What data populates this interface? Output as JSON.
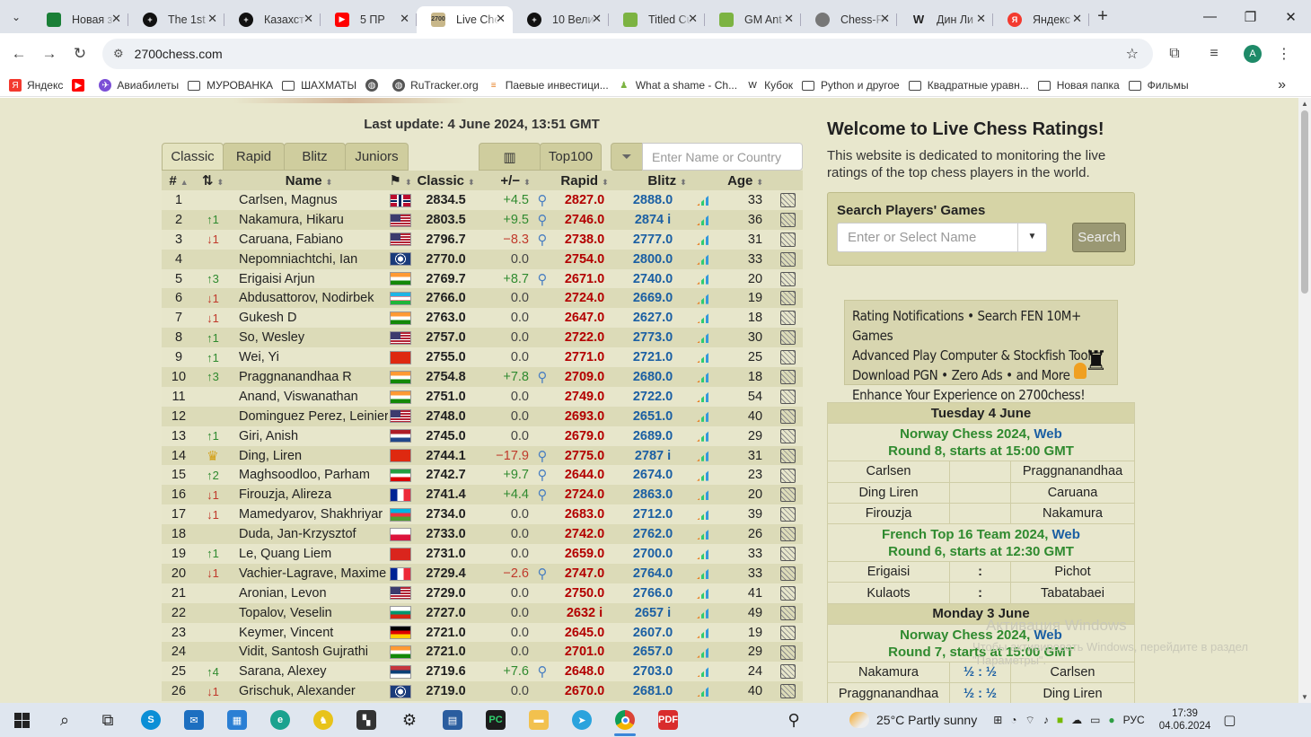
{
  "browser": {
    "tabs": [
      {
        "title": "Новая за",
        "icon": "green-square",
        "color": "#1a7f37",
        "active": false
      },
      {
        "title": "The 1st",
        "icon": "plus-circle",
        "color": "#111111",
        "active": false
      },
      {
        "title": "Казахст",
        "icon": "plus-circle",
        "color": "#111111",
        "active": false
      },
      {
        "title": "5 ПР",
        "icon": "youtube",
        "color": "#ff0000",
        "active": false
      },
      {
        "title": "Live Che",
        "icon": "2700",
        "color": "#c8b78a",
        "active": true
      },
      {
        "title": "10 Вели",
        "icon": "plus-circle",
        "color": "#111111",
        "active": false
      },
      {
        "title": "Titled Cu",
        "icon": "pawn",
        "color": "#7cb342",
        "active": false
      },
      {
        "title": "GM Ant",
        "icon": "pawn",
        "color": "#7cb342",
        "active": false
      },
      {
        "title": "Chess-R",
        "icon": "globe",
        "color": "#777777",
        "active": false
      },
      {
        "title": "Дин Ли",
        "icon": "wikipedia",
        "color": "#222222",
        "active": false
      },
      {
        "title": "Яндекс",
        "icon": "yandex",
        "color": "#f33a2f",
        "active": false
      }
    ],
    "url": "2700chess.com",
    "avatar": "A",
    "bookmarks": [
      {
        "label": "Яндекс",
        "icon": "yandex"
      },
      {
        "label": "",
        "icon": "youtube"
      },
      {
        "label": "Авиабилеты",
        "icon": "aviasales"
      },
      {
        "label": "МУРОВАНКА",
        "icon": "folder"
      },
      {
        "label": "ШАХМАТЫ",
        "icon": "folder"
      },
      {
        "label": "",
        "icon": "globe"
      },
      {
        "label": "RuTracker.org",
        "icon": "globe"
      },
      {
        "label": "Паевые инвестици...",
        "icon": "bars"
      },
      {
        "label": "What a shame - Ch...",
        "icon": "pawn"
      },
      {
        "label": "Кубок",
        "icon": "wikipedia"
      },
      {
        "label": "Python и другое",
        "icon": "folder"
      },
      {
        "label": "Квадратные уравн...",
        "icon": "folder"
      },
      {
        "label": "Новая папка",
        "icon": "folder"
      },
      {
        "label": "Фильмы",
        "icon": "folder"
      }
    ]
  },
  "page": {
    "last_update": "Last update: 4 June 2024, 13:51 GMT",
    "tabs": [
      "Classic",
      "Rapid",
      "Blitz",
      "Juniors"
    ],
    "top100": "Top100",
    "filter_placeholder": "Enter Name or Country",
    "columns": {
      "rank": "#",
      "name": "Name",
      "classic": "Classic",
      "delta": "+/−",
      "rapid": "Rapid",
      "blitz": "Blitz",
      "age": "Age"
    },
    "players": [
      {
        "rank": "1",
        "chg": "",
        "chg_type": "",
        "name": "Carlsen, Magnus",
        "flag": "no",
        "classic": "2834.5",
        "delta": "+4.5",
        "mag": true,
        "rapid": "2827.0",
        "blitz": "2888.0",
        "age": "33"
      },
      {
        "rank": "2",
        "chg": "↑1",
        "chg_type": "up",
        "name": "Nakamura, Hikaru",
        "flag": "us",
        "classic": "2803.5",
        "delta": "+9.5",
        "mag": true,
        "rapid": "2746.0",
        "blitz": "2874 i",
        "age": "36"
      },
      {
        "rank": "3",
        "chg": "↓1",
        "chg_type": "dn",
        "name": "Caruana, Fabiano",
        "flag": "us",
        "classic": "2796.7",
        "delta": "−8.3",
        "mag": true,
        "rapid": "2738.0",
        "blitz": "2777.0",
        "age": "31"
      },
      {
        "rank": "4",
        "chg": "",
        "chg_type": "",
        "name": "Nepomniachtchi, Ian",
        "flag": "fide",
        "classic": "2770.0",
        "delta": "0.0",
        "mag": false,
        "rapid": "2754.0",
        "blitz": "2800.0",
        "age": "33"
      },
      {
        "rank": "5",
        "chg": "↑3",
        "chg_type": "up",
        "name": "Erigaisi Arjun",
        "flag": "in",
        "classic": "2769.7",
        "delta": "+8.7",
        "mag": true,
        "rapid": "2671.0",
        "blitz": "2740.0",
        "age": "20"
      },
      {
        "rank": "6",
        "chg": "↓1",
        "chg_type": "dn",
        "name": "Abdusattorov, Nodirbek",
        "flag": "uz",
        "classic": "2766.0",
        "delta": "0.0",
        "mag": false,
        "rapid": "2724.0",
        "blitz": "2669.0",
        "age": "19"
      },
      {
        "rank": "7",
        "chg": "↓1",
        "chg_type": "dn",
        "name": "Gukesh D",
        "flag": "in",
        "classic": "2763.0",
        "delta": "0.0",
        "mag": false,
        "rapid": "2647.0",
        "blitz": "2627.0",
        "age": "18"
      },
      {
        "rank": "8",
        "chg": "↑1",
        "chg_type": "up",
        "name": "So, Wesley",
        "flag": "us",
        "classic": "2757.0",
        "delta": "0.0",
        "mag": false,
        "rapid": "2722.0",
        "blitz": "2773.0",
        "age": "30"
      },
      {
        "rank": "9",
        "chg": "↑1",
        "chg_type": "up",
        "name": "Wei, Yi",
        "flag": "cn",
        "classic": "2755.0",
        "delta": "0.0",
        "mag": false,
        "rapid": "2771.0",
        "blitz": "2721.0",
        "age": "25"
      },
      {
        "rank": "10",
        "chg": "↑3",
        "chg_type": "up",
        "name": "Praggnanandhaa R",
        "flag": "in",
        "classic": "2754.8",
        "delta": "+7.8",
        "mag": true,
        "rapid": "2709.0",
        "blitz": "2680.0",
        "age": "18"
      },
      {
        "rank": "11",
        "chg": "",
        "chg_type": "",
        "name": "Anand, Viswanathan",
        "flag": "in",
        "classic": "2751.0",
        "delta": "0.0",
        "mag": false,
        "rapid": "2749.0",
        "blitz": "2722.0",
        "age": "54"
      },
      {
        "rank": "12",
        "chg": "",
        "chg_type": "",
        "name": "Dominguez Perez, Leinier",
        "flag": "us",
        "classic": "2748.0",
        "delta": "0.0",
        "mag": false,
        "rapid": "2693.0",
        "blitz": "2651.0",
        "age": "40"
      },
      {
        "rank": "13",
        "chg": "↑1",
        "chg_type": "up",
        "name": "Giri, Anish",
        "flag": "nl",
        "classic": "2745.0",
        "delta": "0.0",
        "mag": false,
        "rapid": "2679.0",
        "blitz": "2689.0",
        "age": "29"
      },
      {
        "rank": "14",
        "chg": "♛",
        "chg_type": "crown",
        "name": "Ding, Liren",
        "flag": "cn",
        "classic": "2744.1",
        "delta": "−17.9",
        "mag": true,
        "rapid": "2775.0",
        "blitz": "2787 i",
        "age": "31"
      },
      {
        "rank": "15",
        "chg": "↑2",
        "chg_type": "up",
        "name": "Maghsoodloo, Parham",
        "flag": "ir",
        "classic": "2742.7",
        "delta": "+9.7",
        "mag": true,
        "rapid": "2644.0",
        "blitz": "2674.0",
        "age": "23"
      },
      {
        "rank": "16",
        "chg": "↓1",
        "chg_type": "dn",
        "name": "Firouzja, Alireza",
        "flag": "fr",
        "classic": "2741.4",
        "delta": "+4.4",
        "mag": true,
        "rapid": "2724.0",
        "blitz": "2863.0",
        "age": "20"
      },
      {
        "rank": "17",
        "chg": "↓1",
        "chg_type": "dn",
        "name": "Mamedyarov, Shakhriyar",
        "flag": "az",
        "classic": "2734.0",
        "delta": "0.0",
        "mag": false,
        "rapid": "2683.0",
        "blitz": "2712.0",
        "age": "39"
      },
      {
        "rank": "18",
        "chg": "",
        "chg_type": "",
        "name": "Duda, Jan-Krzysztof",
        "flag": "pl",
        "classic": "2733.0",
        "delta": "0.0",
        "mag": false,
        "rapid": "2742.0",
        "blitz": "2762.0",
        "age": "26"
      },
      {
        "rank": "19",
        "chg": "↑1",
        "chg_type": "up",
        "name": "Le, Quang Liem",
        "flag": "vn",
        "classic": "2731.0",
        "delta": "0.0",
        "mag": false,
        "rapid": "2659.0",
        "blitz": "2700.0",
        "age": "33"
      },
      {
        "rank": "20",
        "chg": "↓1",
        "chg_type": "dn",
        "name": "Vachier-Lagrave, Maxime",
        "flag": "fr",
        "classic": "2729.4",
        "delta": "−2.6",
        "mag": true,
        "rapid": "2747.0",
        "blitz": "2764.0",
        "age": "33"
      },
      {
        "rank": "21",
        "chg": "",
        "chg_type": "",
        "name": "Aronian, Levon",
        "flag": "us",
        "classic": "2729.0",
        "delta": "0.0",
        "mag": false,
        "rapid": "2750.0",
        "blitz": "2766.0",
        "age": "41"
      },
      {
        "rank": "22",
        "chg": "",
        "chg_type": "",
        "name": "Topalov, Veselin",
        "flag": "bg",
        "classic": "2727.0",
        "delta": "0.0",
        "mag": false,
        "rapid": "2632 i",
        "blitz": "2657 i",
        "age": "49"
      },
      {
        "rank": "23",
        "chg": "",
        "chg_type": "",
        "name": "Keymer, Vincent",
        "flag": "de",
        "classic": "2721.0",
        "delta": "0.0",
        "mag": false,
        "rapid": "2645.0",
        "blitz": "2607.0",
        "age": "19"
      },
      {
        "rank": "24",
        "chg": "",
        "chg_type": "",
        "name": "Vidit, Santosh Gujrathi",
        "flag": "in",
        "classic": "2721.0",
        "delta": "0.0",
        "mag": false,
        "rapid": "2701.0",
        "blitz": "2657.0",
        "age": "29"
      },
      {
        "rank": "25",
        "chg": "↑4",
        "chg_type": "up",
        "name": "Sarana, Alexey",
        "flag": "rs",
        "classic": "2719.6",
        "delta": "+7.6",
        "mag": true,
        "rapid": "2648.0",
        "blitz": "2703.0",
        "age": "24"
      },
      {
        "rank": "26",
        "chg": "↓1",
        "chg_type": "dn",
        "name": "Grischuk, Alexander",
        "flag": "fide",
        "classic": "2719.0",
        "delta": "0.0",
        "mag": false,
        "rapid": "2670.0",
        "blitz": "2681.0",
        "age": "40"
      }
    ]
  },
  "sidebar": {
    "welcome_title": "Welcome to Live Chess Ratings!",
    "welcome_text": "This website is dedicated to monitoring the live ratings of the top chess players in the world.",
    "search_heading": "Search Players' Games",
    "name_placeholder": "Enter or Select Name",
    "search_button": "Search",
    "promo_lines": [
      "Rating Notifications • Search FEN 10M+ Games",
      "Advanced Play Computer & Stockfish Tools",
      "Download PGN • Zero Ads • and More",
      "Enhance Your Experience on 2700chess!"
    ],
    "events": [
      {
        "type": "day",
        "text": "Tuesday 4 June"
      },
      {
        "type": "tour",
        "name": "Norway Chess 2024, ",
        "web": "Web",
        "round": "Round 8, starts at 15:00 GMT"
      },
      {
        "type": "game",
        "white": "Carlsen",
        "res": "",
        "black": "Praggnanandhaa"
      },
      {
        "type": "game",
        "white": "Ding Liren",
        "res": "",
        "black": "Caruana"
      },
      {
        "type": "game",
        "white": "Firouzja",
        "res": "",
        "black": "Nakamura"
      },
      {
        "type": "tour",
        "name": "French Top 16 Team 2024, ",
        "web": "Web",
        "round": "Round 6, starts at 12:30 GMT"
      },
      {
        "type": "game",
        "white": "Erigaisi",
        "res": ":",
        "black": "Pichot"
      },
      {
        "type": "game",
        "white": "Kulaots",
        "res": ":",
        "black": "Tabatabaei"
      },
      {
        "type": "day",
        "text": "Monday 3 June"
      },
      {
        "type": "tour",
        "name": "Norway Chess 2024, ",
        "web": "Web",
        "round": "Round 7, starts at 15:00 GMT"
      },
      {
        "type": "game",
        "white": "Nakamura",
        "res": "½ : ½",
        "black": "Carlsen"
      },
      {
        "type": "game",
        "white": "Praggnanandhaa",
        "res": "½ : ½",
        "black": "Ding Liren"
      }
    ]
  },
  "watermark": {
    "line1": "Активация Windows",
    "line2": "Чтобы активировать Windows, перейдите в раздел \"Параметры\"."
  },
  "taskbar": {
    "weather_temp": "25°C",
    "weather_text": "Partly sunny",
    "lang": "РУС",
    "time": "17:39",
    "date": "04.06.2024"
  },
  "colors": {
    "page_bg": "#e8e7cd",
    "classic": "#222222",
    "rapid": "#b30000",
    "blitz": "#1b5fa3",
    "up": "#2f8a2f",
    "down": "#c0392b"
  }
}
